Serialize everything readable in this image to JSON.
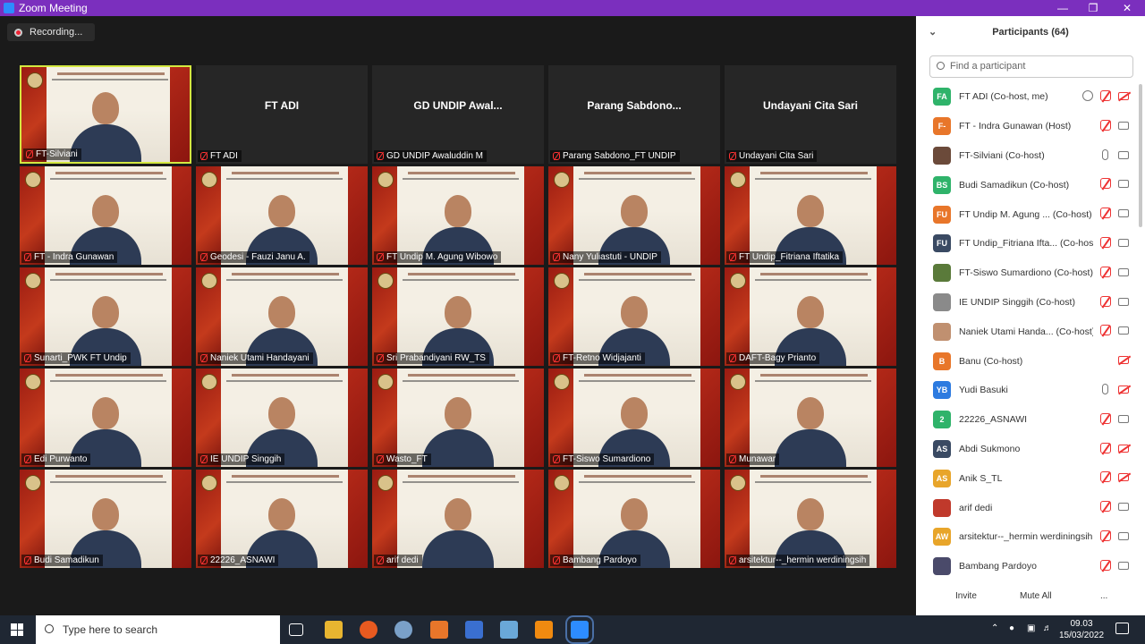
{
  "window": {
    "title": "Zoom Meeting"
  },
  "recording": {
    "label": "Recording..."
  },
  "tiles": [
    {
      "label": "FT-Silviani",
      "kind": "video",
      "active": true
    },
    {
      "label": "FT ADI",
      "kind": "name",
      "big": "FT ADI"
    },
    {
      "label": "GD UNDIP Awaluddin M",
      "kind": "name",
      "big": "GD UNDIP Awal..."
    },
    {
      "label": "Parang Sabdono_FT UNDIP",
      "kind": "name",
      "big": "Parang Sabdono..."
    },
    {
      "label": "Undayani Cita Sari",
      "kind": "name",
      "big": "Undayani Cita Sari"
    },
    {
      "label": "FT - Indra Gunawan",
      "kind": "video"
    },
    {
      "label": "Geodesi - Fauzi Janu A.",
      "kind": "video"
    },
    {
      "label": "FT Undip M. Agung Wibowo",
      "kind": "video"
    },
    {
      "label": "Nany Yuliastuti - UNDIP",
      "kind": "video"
    },
    {
      "label": "FT Undip_Fitriana Iftatika",
      "kind": "video"
    },
    {
      "label": "Sunarti_PWK FT Undip",
      "kind": "video"
    },
    {
      "label": "Naniek Utami Handayani",
      "kind": "video"
    },
    {
      "label": "Sri Prabandiyani RW_TS",
      "kind": "video"
    },
    {
      "label": "FT-Retno Widjajanti",
      "kind": "video"
    },
    {
      "label": "DAFT-Bagy Prianto",
      "kind": "video"
    },
    {
      "label": "Edi Purwanto",
      "kind": "video"
    },
    {
      "label": "IE UNDIP Singgih",
      "kind": "video"
    },
    {
      "label": "Wasto_FT",
      "kind": "video"
    },
    {
      "label": "FT-Siswo Sumardiono",
      "kind": "video"
    },
    {
      "label": "Munawar",
      "kind": "video"
    },
    {
      "label": "Budi Samadikun",
      "kind": "video"
    },
    {
      "label": "22226_ASNAWI",
      "kind": "video"
    },
    {
      "label": "arif dedi",
      "kind": "video"
    },
    {
      "label": "Bambang Pardoyo",
      "kind": "video"
    },
    {
      "label": "arsitektur--_hermin werdiningsih",
      "kind": "video"
    }
  ],
  "participants": {
    "title": "Participants (64)",
    "search_placeholder": "Find a participant",
    "list": [
      {
        "initials": "FA",
        "color": "#2fb36a",
        "name": "FT ADI (Co-host, me)",
        "mic": "off",
        "video": "off",
        "rec": true
      },
      {
        "initials": "F-",
        "color": "#e8762a",
        "name": "FT - Indra Gunawan (Host)",
        "mic": "off",
        "video": "on"
      },
      {
        "initials": "",
        "color": "#6b4a3a",
        "name": "FT-Silviani (Co-host)",
        "mic": "on",
        "video": "on"
      },
      {
        "initials": "BS",
        "color": "#2fb36a",
        "name": "Budi Samadikun (Co-host)",
        "mic": "off",
        "video": "on"
      },
      {
        "initials": "FU",
        "color": "#e8762a",
        "name": "FT Undip M. Agung ... (Co-host)",
        "mic": "off",
        "video": "on"
      },
      {
        "initials": "FU",
        "color": "#3a4a63",
        "name": "FT Undip_Fitriana Ifta... (Co-host)",
        "mic": "off",
        "video": "on"
      },
      {
        "initials": "",
        "color": "#5a7a3a",
        "name": "FT-Siswo Sumardiono (Co-host)",
        "mic": "off",
        "video": "on"
      },
      {
        "initials": "",
        "color": "#8a8a8a",
        "name": "IE UNDIP Singgih (Co-host)",
        "mic": "off",
        "video": "on"
      },
      {
        "initials": "",
        "color": "#c09070",
        "name": "Naniek Utami Handa... (Co-host)",
        "mic": "off",
        "video": "on"
      },
      {
        "initials": "B",
        "color": "#e8762a",
        "name": "Banu (Co-host)",
        "mic": "none",
        "video": "off"
      },
      {
        "initials": "YB",
        "color": "#2d7be0",
        "name": "Yudi Basuki",
        "mic": "on",
        "video": "off"
      },
      {
        "initials": "2",
        "color": "#2fb36a",
        "name": "22226_ASNAWI",
        "mic": "off",
        "video": "on"
      },
      {
        "initials": "AS",
        "color": "#3a4a63",
        "name": "Abdi Sukmono",
        "mic": "off",
        "video": "off"
      },
      {
        "initials": "AS",
        "color": "#e8a52a",
        "name": "Anik S_TL",
        "mic": "off",
        "video": "off"
      },
      {
        "initials": "",
        "color": "#c0392b",
        "name": "arif dedi",
        "mic": "off",
        "video": "on"
      },
      {
        "initials": "AW",
        "color": "#e8a52a",
        "name": "arsitektur--_hermin werdiningsih",
        "mic": "off",
        "video": "on"
      },
      {
        "initials": "",
        "color": "#4a4a6a",
        "name": "Bambang Pardoyo",
        "mic": "off",
        "video": "on"
      }
    ],
    "invite_label": "Invite",
    "mute_all_label": "Mute All",
    "more_label": "..."
  },
  "taskbar": {
    "search_placeholder": "Type here to search",
    "time": "09.03",
    "date": "15/03/2022"
  }
}
